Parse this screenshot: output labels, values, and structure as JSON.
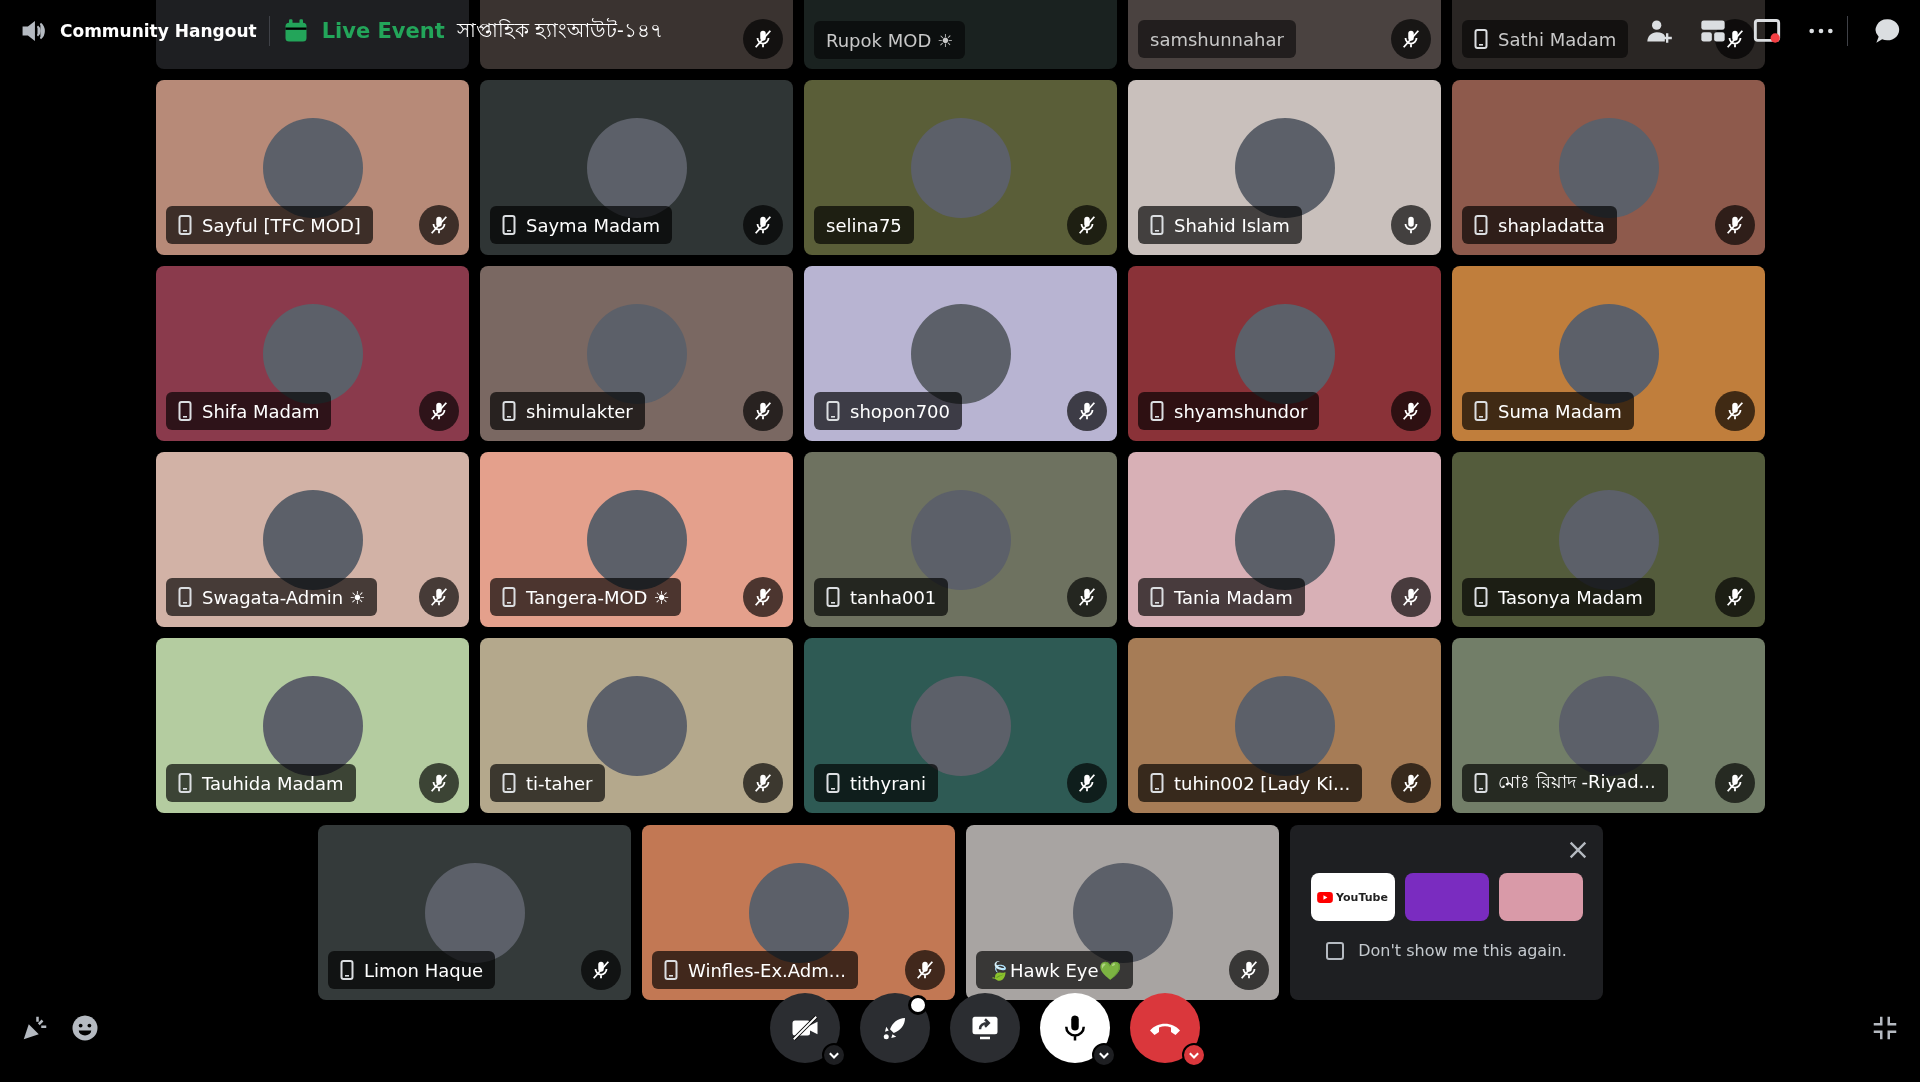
{
  "header": {
    "channel": "Community Hangout",
    "event_label": "Live Event",
    "event_title": "সাপ্তাহিক হ্যাংআউট-১৪৭"
  },
  "top_row": [
    {
      "color": "#1e1f22"
    },
    {
      "color": "#3a3330",
      "muted": true
    },
    {
      "name": "Rupok MOD ☀",
      "color": "#1a2220",
      "mobile": false
    },
    {
      "name": "samshunnahar",
      "color": "#4a4240",
      "mobile": false,
      "muted": true
    },
    {
      "name": "Sathi Madam",
      "color": "#2a2624",
      "mobile": true,
      "muted": true
    }
  ],
  "tiles": [
    {
      "name": "Sayful [TFC MOD]",
      "color": "#b78a78",
      "mobile": true,
      "muted": true
    },
    {
      "name": "Sayma Madam",
      "color": "#2f3535",
      "mobile": true,
      "muted": true
    },
    {
      "name": "selina75",
      "color": "#5a5e38",
      "mobile": false,
      "muted": true
    },
    {
      "name": "Shahid Islam",
      "color": "#c9c0bc",
      "mobile": true,
      "muted": false
    },
    {
      "name": "shapladatta",
      "color": "#8e5a4c",
      "mobile": true,
      "muted": true
    },
    {
      "name": "Shifa Madam",
      "color": "#8a3a4c",
      "mobile": true,
      "muted": true
    },
    {
      "name": "shimulakter",
      "color": "#7a6862",
      "mobile": true,
      "muted": true
    },
    {
      "name": "shopon700",
      "color": "#b8b4d2",
      "mobile": true,
      "muted": true
    },
    {
      "name": "shyamshundor",
      "color": "#8a3238",
      "mobile": true,
      "muted": true
    },
    {
      "name": "Suma Madam",
      "color": "#c07e3c",
      "mobile": true,
      "muted": true
    },
    {
      "name": "Swagata-Admin ☀",
      "color": "#d2b2a6",
      "mobile": true,
      "muted": true
    },
    {
      "name": "Tangera-MOD ☀",
      "color": "#e4a08c",
      "mobile": true,
      "muted": true
    },
    {
      "name": "tanha001",
      "color": "#6e7260",
      "mobile": true,
      "muted": true
    },
    {
      "name": "Tania Madam",
      "color": "#d8b0b6",
      "mobile": true,
      "muted": true
    },
    {
      "name": "Tasonya Madam",
      "color": "#545c3c",
      "mobile": true,
      "muted": true
    },
    {
      "name": "Tauhida Madam",
      "color": "#b4cca0",
      "mobile": true,
      "muted": true
    },
    {
      "name": "ti-taher",
      "color": "#b4a88c",
      "mobile": true,
      "muted": true
    },
    {
      "name": "tithyrani",
      "color": "#2e5a54",
      "mobile": true,
      "muted": true
    },
    {
      "name": "tuhin002 [Lady Ki...",
      "color": "#a67c56",
      "mobile": true,
      "muted": true
    },
    {
      "name": "মোঃ রিয়াদ -Riyad...",
      "color": "#727e68",
      "mobile": true,
      "muted": true
    }
  ],
  "bottom_row": [
    {
      "name": "Limon Haque",
      "color": "#343a3a",
      "mobile": true,
      "muted": true
    },
    {
      "name": "Winfles-Ex.Adm...",
      "color": "#c27854",
      "mobile": true,
      "muted": true
    },
    {
      "name": "🍃Hawk Eye💚",
      "color": "#a8a4a2",
      "mobile": false,
      "muted": true
    }
  ],
  "promo": {
    "youtube_label": "YouTube",
    "dont_show": {
      "label": "Don't show me this again.",
      "checked": false
    }
  },
  "controls": [
    {
      "kind": "camera",
      "on": false
    },
    {
      "kind": "activity"
    },
    {
      "kind": "share"
    },
    {
      "kind": "mic",
      "on": true
    },
    {
      "kind": "leave"
    }
  ]
}
